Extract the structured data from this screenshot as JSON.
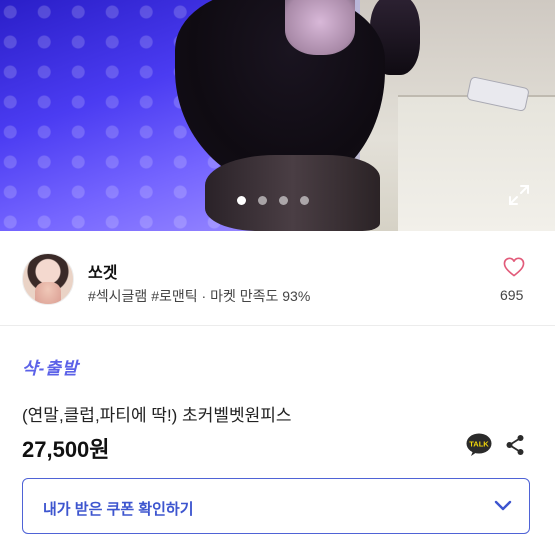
{
  "hero": {
    "slide_count": 4,
    "active_slide": 1
  },
  "seller": {
    "name": "쏘겟",
    "tags": "#섹시글램 #로맨틱 · 마켓 만족도 93%",
    "like_count": "695"
  },
  "product": {
    "shipping_label": "샥-출발",
    "title": "(연말,클럽,파티에 딱!) 초커벨벳원피스",
    "price": "27,500원",
    "talk_badge": "TALK"
  },
  "coupon": {
    "label": "내가 받은 쿠폰 확인하기"
  },
  "colors": {
    "accent_blue": "#4f63d6",
    "heart_pink": "#e25b7a",
    "ship_purple": "#5b61e8",
    "kakao_icon_bg": "#2b2b2b"
  },
  "icons": [
    "expand-icon",
    "heart-icon",
    "kakao-talk-icon",
    "share-icon",
    "chevron-down-icon"
  ]
}
